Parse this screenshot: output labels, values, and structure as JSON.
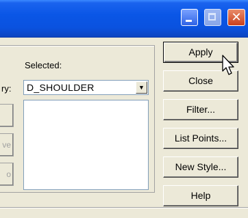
{
  "window": {
    "controls": {
      "minimize_icon": "minimize-icon",
      "maximize_icon": "maximize-icon",
      "close_icon": "close-icon",
      "close_glyph": "✕"
    }
  },
  "left_stubs": [
    "",
    "ve",
    "o"
  ],
  "category_label_fragment": "ry:",
  "selected": {
    "label": "Selected:",
    "combo_value": "D_SHOULDER"
  },
  "buttons": {
    "apply": "Apply",
    "close": "Close",
    "filter": "Filter...",
    "list_points": "List Points...",
    "new_style": "New Style...",
    "help": "Help"
  },
  "colors": {
    "titlebar": "#0a56e6",
    "face": "#ece9d8",
    "close_button": "#c9401c"
  }
}
